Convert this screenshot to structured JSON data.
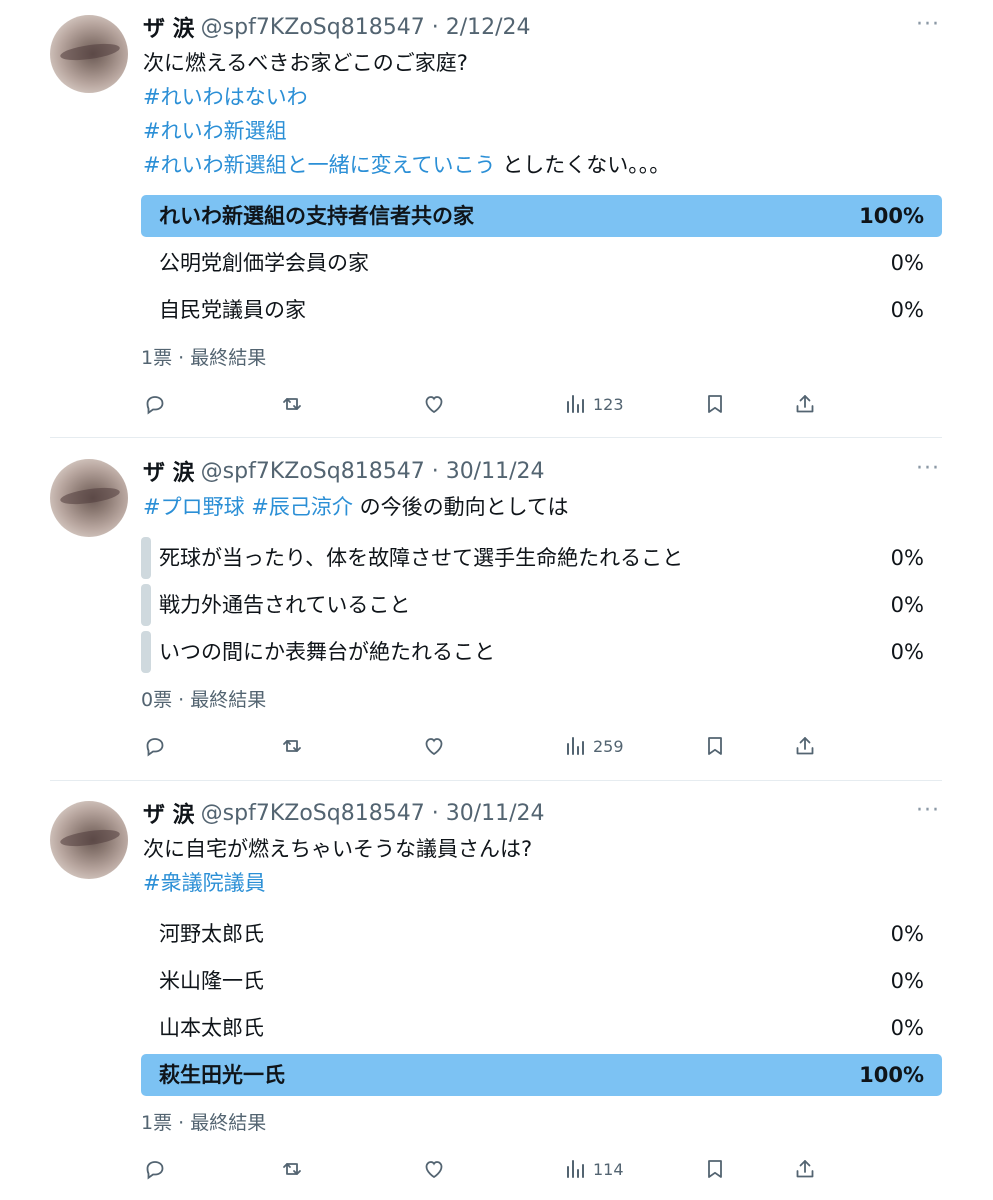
{
  "tweets": [
    {
      "name": "ザ 涙",
      "handle": "@spf7KZoSq818547 · 2/12/24",
      "more": "···",
      "lines": [
        {
          "parts": [
            {
              "t": "次に燃えるべきお家どこのご家庭?",
              "tag": false
            }
          ]
        },
        {
          "parts": [
            {
              "t": "#れいわはないわ",
              "tag": true
            }
          ]
        },
        {
          "parts": [
            {
              "t": "#れいわ新選組",
              "tag": true
            }
          ]
        },
        {
          "parts": [
            {
              "t": "#れいわ新選組と一緒に変えていこう",
              "tag": true
            },
            {
              "t": " としたくない。。。",
              "tag": false
            }
          ]
        }
      ],
      "options": [
        {
          "label": "れいわ新選組の支持者信者共の家",
          "percent": "100%",
          "value": 100,
          "winner": true
        },
        {
          "label": "公明党創価学会員の家",
          "percent": "0%",
          "value": 0,
          "winner": false
        },
        {
          "label": "自民党議員の家",
          "percent": "0%",
          "value": 0,
          "winner": false
        }
      ],
      "meta": "1票 · 最終結果",
      "views": "123"
    },
    {
      "name": "ザ 涙",
      "handle": "@spf7KZoSq818547 · 30/11/24",
      "more": "···",
      "lines": [
        {
          "parts": [
            {
              "t": "#プロ野球",
              "tag": true
            },
            {
              "t": " ",
              "tag": false
            },
            {
              "t": "#辰己涼介",
              "tag": true
            },
            {
              "t": " の今後の動向としては",
              "tag": false
            }
          ]
        }
      ],
      "options": [
        {
          "label": "死球が当ったり、体を故障させて選手生命絶たれること",
          "percent": "0%",
          "value": 0,
          "winner": false
        },
        {
          "label": "戦力外通告されていること",
          "percent": "0%",
          "value": 0,
          "winner": false
        },
        {
          "label": "いつの間にか表舞台が絶たれること",
          "percent": "0%",
          "value": 0,
          "winner": false
        }
      ],
      "meta": "0票 · 最終結果",
      "views": "259"
    },
    {
      "name": "ザ 涙",
      "handle": "@spf7KZoSq818547 · 30/11/24",
      "more": "···",
      "lines": [
        {
          "parts": [
            {
              "t": "次に自宅が燃えちゃいそうな議員さんは?",
              "tag": false
            }
          ]
        },
        {
          "parts": [
            {
              "t": "#衆議院議員",
              "tag": true
            }
          ]
        }
      ],
      "options": [
        {
          "label": "河野太郎氏",
          "percent": "0%",
          "value": 0,
          "winner": false
        },
        {
          "label": "米山隆一氏",
          "percent": "0%",
          "value": 0,
          "winner": false
        },
        {
          "label": "山本太郎氏",
          "percent": "0%",
          "value": 0,
          "winner": false
        },
        {
          "label": "萩生田光一氏",
          "percent": "100%",
          "value": 100,
          "winner": true
        }
      ],
      "meta": "1票 · 最終結果",
      "views": "114"
    }
  ],
  "icons": {
    "reply": "reply-icon",
    "retweet": "retweet-icon",
    "like": "like-icon",
    "views": "views-icon",
    "bookmark": "bookmark-icon",
    "share": "share-icon"
  },
  "colors": {
    "winner_bar": "#7cc2f3",
    "hashtag": "#2b8fd6",
    "muted": "#536471"
  }
}
